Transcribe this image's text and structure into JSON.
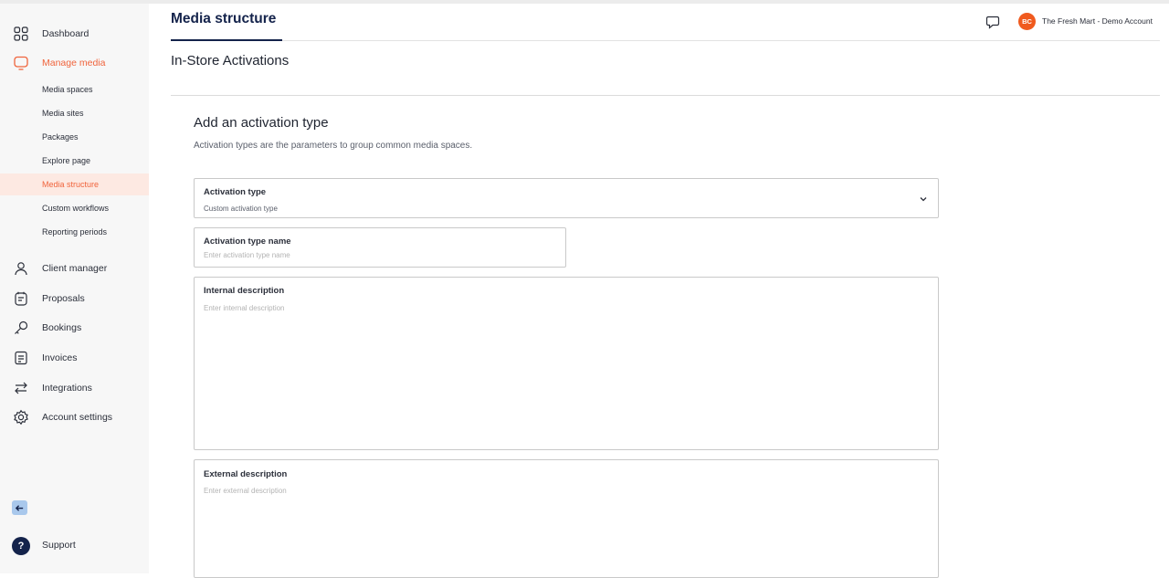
{
  "sidebar": {
    "main_items": [
      {
        "label": "Dashboard",
        "icon": "dashboard-grid-icon"
      },
      {
        "label": "Manage media",
        "icon": "monitor-icon"
      }
    ],
    "sub_items": [
      {
        "label": "Media spaces"
      },
      {
        "label": "Media sites"
      },
      {
        "label": "Packages"
      },
      {
        "label": "Explore page"
      },
      {
        "label": "Media structure"
      },
      {
        "label": "Custom workflows"
      },
      {
        "label": "Reporting periods"
      }
    ],
    "lower_items": [
      {
        "label": "Client manager",
        "icon": "user-icon"
      },
      {
        "label": "Proposals",
        "icon": "proposals-icon"
      },
      {
        "label": "Bookings",
        "icon": "key-icon"
      },
      {
        "label": "Invoices",
        "icon": "invoice-icon"
      },
      {
        "label": "Integrations",
        "icon": "arrows-exchange-icon"
      },
      {
        "label": "Account settings",
        "icon": "gear-icon"
      }
    ],
    "collapse_icon": "arrow-left-icon",
    "support_label": "Support",
    "support_icon_glyph": "?"
  },
  "header": {
    "tab_label": "Media structure",
    "avatar_initials": "BC",
    "account_name": "The Fresh Mart - Demo Account"
  },
  "page": {
    "title": "In-Store Activations"
  },
  "form": {
    "heading": "Add an activation type",
    "subheading": "Activation types are the parameters to group common media spaces.",
    "activation_type": {
      "label": "Activation type",
      "value": "Custom activation type"
    },
    "activation_type_name": {
      "label": "Activation type name",
      "placeholder": "Enter activation type name"
    },
    "internal_description": {
      "label": "Internal description",
      "placeholder": "Enter internal description"
    },
    "external_description": {
      "label": "External description",
      "placeholder": "Enter external description"
    }
  },
  "colors": {
    "accent": "#f0643c",
    "active_bg": "#fde9e2",
    "navy": "#14234b",
    "avatar": "#f05a1e"
  }
}
